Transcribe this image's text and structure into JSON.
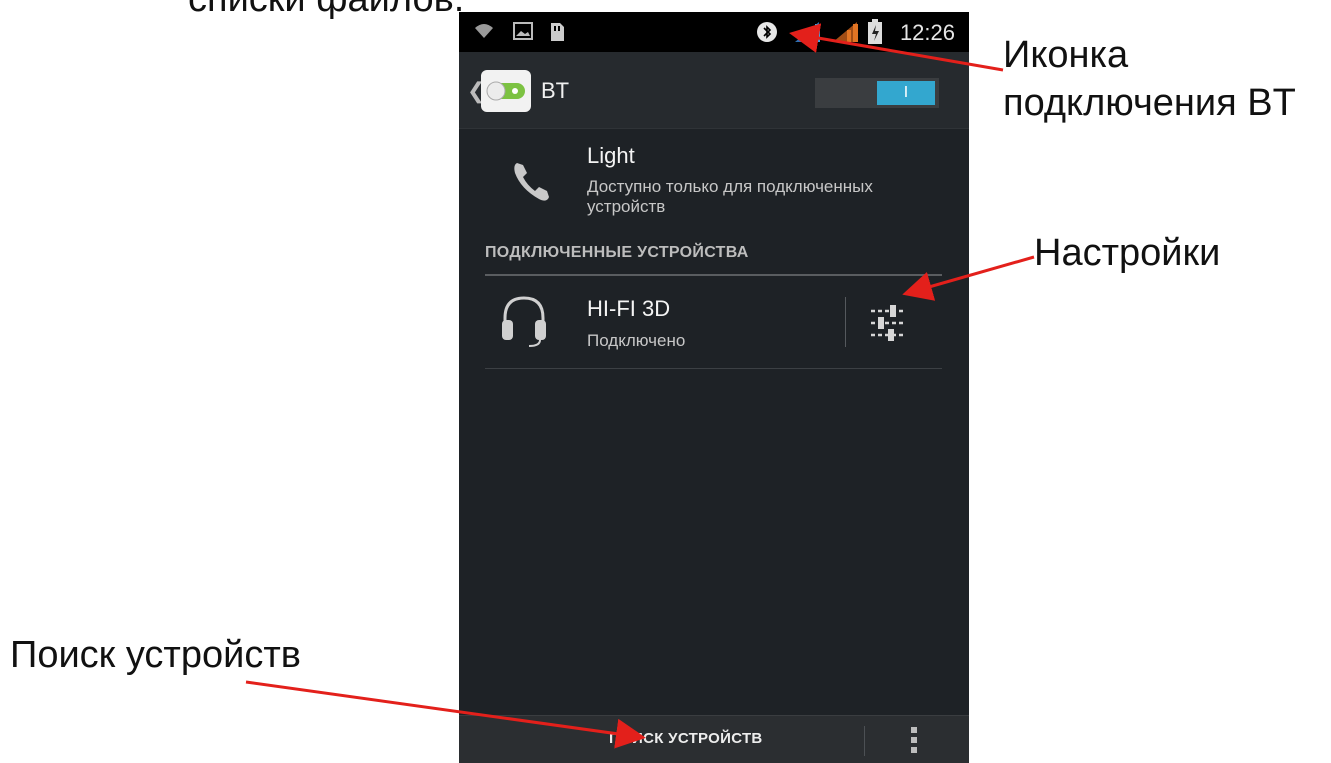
{
  "slide": {
    "cut_text": "списки файлов."
  },
  "annotations": {
    "bt_icon_line1": "Иконка",
    "bt_icon_line2": "подключения BT",
    "settings": "Настройки",
    "search": "Поиск устройств",
    "arrow_color": "#e3201b"
  },
  "statusbar": {
    "time": "12:26",
    "icons": [
      "wifi-icon",
      "image-icon",
      "sd-card-icon",
      "bluetooth-connected-icon",
      "signal-icon",
      "signal-icon",
      "battery-icon"
    ]
  },
  "actionbar": {
    "title": "BT",
    "toggle_label": "I",
    "toggle_color": "#33a7cf"
  },
  "device": {
    "name": "Light",
    "visibility": "Доступно только для подключенных устройств"
  },
  "paired": {
    "header": "ПОДКЛЮЧЕННЫЕ УСТРОЙСТВА",
    "items": [
      {
        "name": "HI-FI 3D",
        "status": "Подключено",
        "icon": "headset-icon"
      }
    ]
  },
  "bottombar": {
    "search_label": "ПОИСК УСТРОЙСТВ"
  }
}
